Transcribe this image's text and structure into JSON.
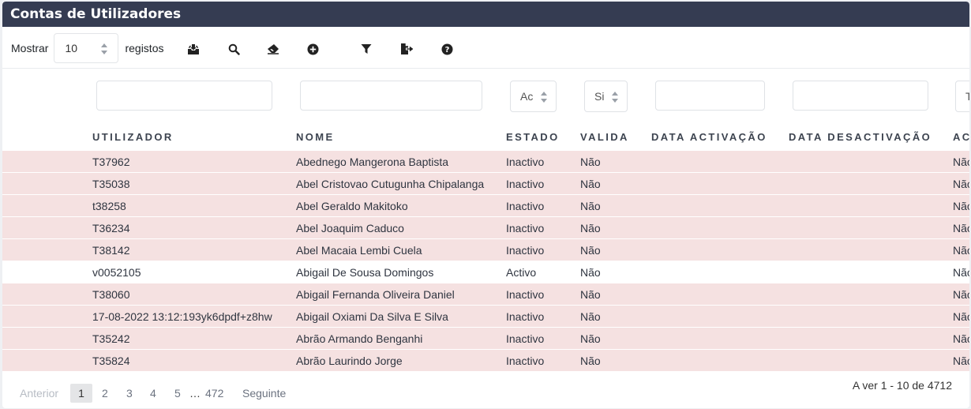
{
  "title": "Contas de Utilizadores",
  "toolbar": {
    "show_label": "Mostrar",
    "page_length": "10",
    "records_label": "registos",
    "icons": [
      "inbox-download-icon",
      "search-icon",
      "eraser-icon",
      "plus-circle-icon",
      "filter-icon",
      "export-icon",
      "help-icon"
    ]
  },
  "filters": {
    "estado_value": "Ac",
    "valida_value": "Si",
    "truncated_value": "T"
  },
  "columns": [
    "UTILIZADOR",
    "NOME",
    "ESTADO",
    "VALIDA",
    "DATA ACTIVAÇÃO",
    "DATA DESACTIVAÇÃO",
    "AC"
  ],
  "rows": [
    {
      "utilizador": "T37962",
      "nome": "Abednego Mangerona Baptista",
      "estado": "Inactivo",
      "valida": "Não",
      "data_activacao": "",
      "data_desactivacao": "",
      "ac": "Não"
    },
    {
      "utilizador": "T35038",
      "nome": "Abel Cristovao Cutugunha Chipalanga",
      "estado": "Inactivo",
      "valida": "Não",
      "data_activacao": "",
      "data_desactivacao": "",
      "ac": "Não"
    },
    {
      "utilizador": "t38258",
      "nome": "Abel Geraldo Makitoko",
      "estado": "Inactivo",
      "valida": "Não",
      "data_activacao": "",
      "data_desactivacao": "",
      "ac": "Não"
    },
    {
      "utilizador": "T36234",
      "nome": "Abel Joaquim Caduco",
      "estado": "Inactivo",
      "valida": "Não",
      "data_activacao": "",
      "data_desactivacao": "",
      "ac": "Não"
    },
    {
      "utilizador": "T38142",
      "nome": "Abel Macaia Lembi Cuela",
      "estado": "Inactivo",
      "valida": "Não",
      "data_activacao": "",
      "data_desactivacao": "",
      "ac": "Não"
    },
    {
      "utilizador": "v0052105",
      "nome": "Abigail De Sousa Domingos",
      "estado": "Activo",
      "valida": "Não",
      "data_activacao": "",
      "data_desactivacao": "",
      "ac": "Não"
    },
    {
      "utilizador": "T38060",
      "nome": "Abigail Fernanda Oliveira Daniel",
      "estado": "Inactivo",
      "valida": "Não",
      "data_activacao": "",
      "data_desactivacao": "",
      "ac": "Não"
    },
    {
      "utilizador": "17-08-2022 13:12:193yk6dpdf+z8hw",
      "nome": "Abigail Oxiami Da Silva E Silva",
      "estado": "Inactivo",
      "valida": "Não",
      "data_activacao": "",
      "data_desactivacao": "",
      "ac": "Não"
    },
    {
      "utilizador": "T35242",
      "nome": "Abrão Armando Benganhi",
      "estado": "Inactivo",
      "valida": "Não",
      "data_activacao": "",
      "data_desactivacao": "",
      "ac": "Não"
    },
    {
      "utilizador": "T35824",
      "nome": "Abrão Laurindo Jorge",
      "estado": "Inactivo",
      "valida": "Não",
      "data_activacao": "",
      "data_desactivacao": "",
      "ac": "Não"
    }
  ],
  "pagination": {
    "previous": "Anterior",
    "pages": [
      "1",
      "2",
      "3",
      "4",
      "5"
    ],
    "ellipsis": "…",
    "last_page": "472",
    "next": "Seguinte",
    "current": "1"
  },
  "info": "A ver 1 - 10 de 4712"
}
